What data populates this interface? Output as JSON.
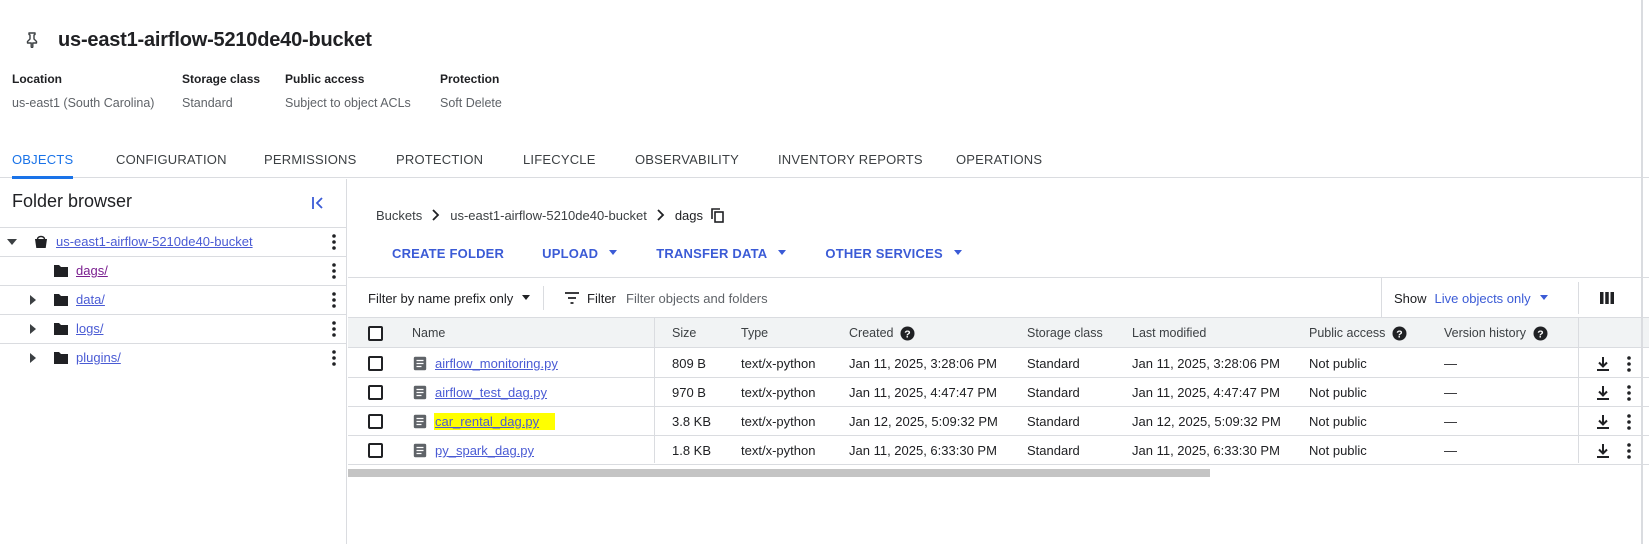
{
  "header": {
    "title": "us-east1-airflow-5210de40-bucket",
    "meta": [
      {
        "label": "Location",
        "value": "us-east1 (South Carolina)"
      },
      {
        "label": "Storage class",
        "value": "Standard"
      },
      {
        "label": "Public access",
        "value": "Subject to object ACLs"
      },
      {
        "label": "Protection",
        "value": "Soft Delete"
      }
    ]
  },
  "tabs": [
    "OBJECTS",
    "CONFIGURATION",
    "PERMISSIONS",
    "PROTECTION",
    "LIFECYCLE",
    "OBSERVABILITY",
    "INVENTORY REPORTS",
    "OPERATIONS"
  ],
  "active_tab": "OBJECTS",
  "folder_browser": {
    "title": "Folder browser",
    "bucket": "us-east1-airflow-5210de40-bucket",
    "folders": [
      "dags/",
      "data/",
      "logs/",
      "plugins/"
    ]
  },
  "breadcrumb": {
    "root": "Buckets",
    "bucket": "us-east1-airflow-5210de40-bucket",
    "current": "dags"
  },
  "actions": {
    "create_folder": "CREATE FOLDER",
    "upload": "UPLOAD",
    "transfer_data": "TRANSFER DATA",
    "other_services": "OTHER SERVICES"
  },
  "filter": {
    "mode": "Filter by name prefix only",
    "filter_label": "Filter",
    "placeholder": "Filter objects and folders",
    "show_label": "Show",
    "show_value": "Live objects only"
  },
  "table": {
    "headers": {
      "name": "Name",
      "size": "Size",
      "type": "Type",
      "created": "Created",
      "storage_class": "Storage class",
      "last_modified": "Last modified",
      "public_access": "Public access",
      "version_history": "Version history"
    },
    "rows": [
      {
        "name": "airflow_monitoring.py",
        "size": "809 B",
        "type": "text/x-python",
        "created": "Jan 11, 2025, 3:28:06 PM",
        "storage_class": "Standard",
        "last_modified": "Jan 11, 2025, 3:28:06 PM",
        "public_access": "Not public",
        "version_history": "—"
      },
      {
        "name": "airflow_test_dag.py",
        "size": "970 B",
        "type": "text/x-python",
        "created": "Jan 11, 2025, 4:47:47 PM",
        "storage_class": "Standard",
        "last_modified": "Jan 11, 2025, 4:47:47 PM",
        "public_access": "Not public",
        "version_history": "—"
      },
      {
        "name": "car_rental_dag.py",
        "size": "3.8 KB",
        "type": "text/x-python",
        "created": "Jan 12, 2025, 5:09:32 PM",
        "storage_class": "Standard",
        "last_modified": "Jan 12, 2025, 5:09:32 PM",
        "public_access": "Not public",
        "version_history": "—"
      },
      {
        "name": "py_spark_dag.py",
        "size": "1.8 KB",
        "type": "text/x-python",
        "created": "Jan 11, 2025, 6:33:30 PM",
        "storage_class": "Standard",
        "last_modified": "Jan 11, 2025, 6:33:30 PM",
        "public_access": "Not public",
        "version_history": "—"
      }
    ]
  },
  "colors": {
    "accent": "#1a73e8",
    "link": "#4a5bd4",
    "highlight": "#ffff00"
  }
}
